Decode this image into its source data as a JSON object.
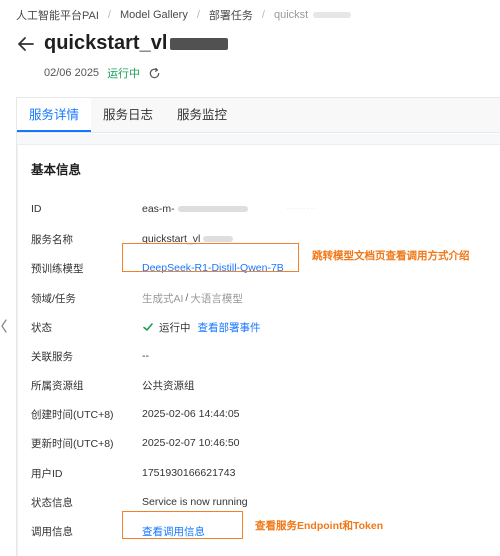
{
  "breadcrumb": {
    "items": [
      "人工智能平台PAI",
      "Model Gallery",
      "部署任务",
      "quickst"
    ],
    "separator": "/"
  },
  "header": {
    "title": "quickstart_vl",
    "date": "02/06 2025",
    "status": "运行中"
  },
  "tabs": [
    "服务详情",
    "服务日志",
    "服务监控"
  ],
  "basic_info": {
    "title": "基本信息",
    "rows": [
      {
        "label": "ID",
        "value": "eas-m-"
      },
      {
        "label": "服务名称",
        "value": "quickstart_vl"
      },
      {
        "label": "预训练模型",
        "value": "DeepSeek-R1-Distill-Qwen-7B"
      },
      {
        "label": "领域/任务",
        "value1": "生成式AI",
        "sep": "/",
        "value2": "大语言模型"
      },
      {
        "label": "状态",
        "status": "运行中",
        "link": "查看部署事件"
      },
      {
        "label": "关联服务",
        "value": "--"
      },
      {
        "label": "所属资源组",
        "value": "公共资源组"
      },
      {
        "label": "创建时间(UTC+8)",
        "value": "2025-02-06 14:44:05"
      },
      {
        "label": "更新时间(UTC+8)",
        "value": "2025-02-07 10:46:50"
      },
      {
        "label": "用户ID",
        "value": "1751930166621743"
      },
      {
        "label": "状态信息",
        "value": "Service is now running"
      },
      {
        "label": "调用信息",
        "link": "查看调用信息"
      }
    ]
  },
  "annotations": {
    "model_note": "跳转模型文档页查看调用方式介绍",
    "call_note": "查看服务Endpoint和Token"
  },
  "colors": {
    "accent": "#1677ff",
    "running": "#18a058",
    "annotation": "#f07818"
  }
}
